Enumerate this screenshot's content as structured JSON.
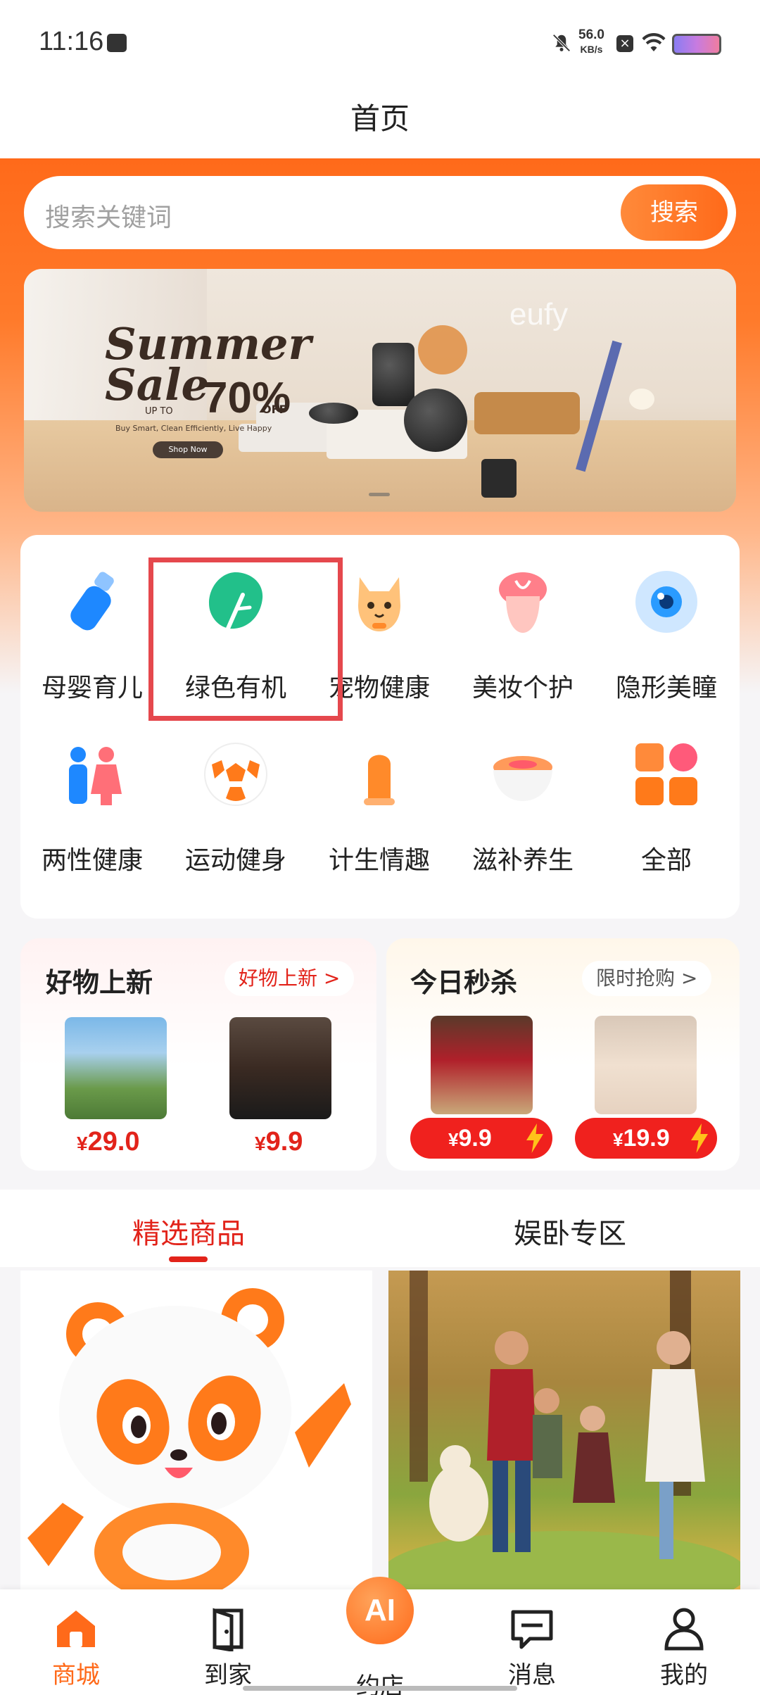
{
  "status_bar": {
    "time": "11:16",
    "speed_value": "56.0",
    "speed_unit": "KB/s"
  },
  "page_title": "首页",
  "search": {
    "placeholder": "搜索关键词",
    "button": "搜索"
  },
  "banner": {
    "brand": "eufy",
    "line1": "Summer",
    "line2": "Sale",
    "upto": "UP TO",
    "percent": "70%",
    "off": "OFF",
    "tagline": "Buy Smart, Clean Efficiently, Live Happy",
    "cta": "Shop Now"
  },
  "categories": [
    {
      "label": "母婴育儿",
      "icon": "baby-bottle-icon",
      "color": "#1e88ff"
    },
    {
      "label": "绿色有机",
      "icon": "green-leaf-icon",
      "color": "#22c08a"
    },
    {
      "label": "宠物健康",
      "icon": "cat-icon",
      "color": "#ffb060"
    },
    {
      "label": "美妆个护",
      "icon": "beauty-icon",
      "color": "#ff7f8a"
    },
    {
      "label": "隐形美瞳",
      "icon": "eye-lens-icon",
      "color": "#2a9bff"
    },
    {
      "label": "两性健康",
      "icon": "couple-icon",
      "color": "#1e88ff"
    },
    {
      "label": "运动健身",
      "icon": "soccer-ball-icon",
      "color": "#ff7a1a"
    },
    {
      "label": "计生情趣",
      "icon": "condom-icon",
      "color": "#ff8a2a"
    },
    {
      "label": "滋补养生",
      "icon": "bowl-icon",
      "color": "#ff8a3a"
    },
    {
      "label": "全部",
      "icon": "grid-icon",
      "color": "#ff7a2a"
    }
  ],
  "new_goods": {
    "title": "好物上新",
    "tag": "好物上新 >",
    "items": [
      {
        "currency": "¥",
        "price": "29.0",
        "image": "picnic-photo"
      },
      {
        "currency": "¥",
        "price": "9.9",
        "image": "haircut-photo"
      }
    ]
  },
  "flash_sale": {
    "title": "今日秒杀",
    "tag": "限时抢购 >",
    "items": [
      {
        "currency": "¥",
        "price": "9.9",
        "image": "coffee-cups-photo"
      },
      {
        "currency": "¥",
        "price": "19.9",
        "image": "facial-photo"
      }
    ]
  },
  "tabs": [
    {
      "label": "精选商品",
      "active": true
    },
    {
      "label": "娱卧专区",
      "active": false
    }
  ],
  "nav": [
    {
      "label": "商城",
      "icon": "home-icon",
      "active": true
    },
    {
      "label": "到家",
      "icon": "door-icon",
      "active": false
    },
    {
      "label": "约店",
      "icon": "ai-icon",
      "active": false,
      "badge": "AI"
    },
    {
      "label": "消息",
      "icon": "message-icon",
      "active": false
    },
    {
      "label": "我的",
      "icon": "person-icon",
      "active": false
    }
  ],
  "colors": {
    "accent": "#ff6a1a",
    "price_red": "#e2231a",
    "highlight": "#e5484d"
  }
}
